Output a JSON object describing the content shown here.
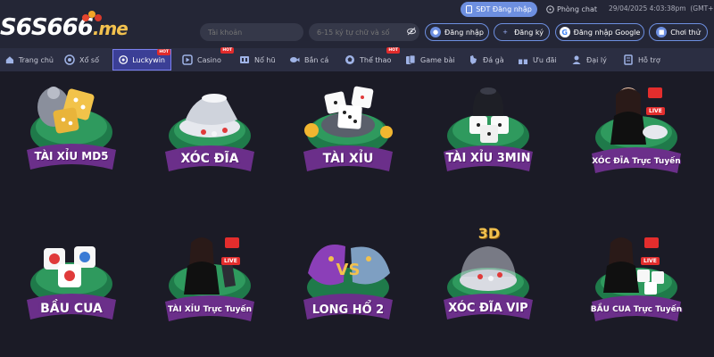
{
  "header": {
    "logo_text": "S6S666",
    "logo_suffix": ".me",
    "sdt_button": "SĐT Đăng nhập",
    "chat_button": "Phòng chat",
    "datetime": "29/04/2025 4:03:38pm",
    "timezone": "(GMT+7)",
    "username_placeholder": "Tài khoản",
    "password_placeholder": "6-15 ký tự chữ và số",
    "login_button": "Đăng nhập",
    "register_button": "Đăng ký",
    "google_button": "Đăng nhập Google",
    "trial_button": "Chơi thử",
    "colors": {
      "accent": "#6d8fe0",
      "background": "#242636"
    }
  },
  "nav": {
    "items": [
      {
        "label": "Trang chủ",
        "icon": "home-icon"
      },
      {
        "label": "Xổ số",
        "icon": "lottery-icon"
      },
      {
        "label": "Luckywin",
        "icon": "luckywin-icon",
        "active": true,
        "hot": "HOT"
      },
      {
        "label": "Casino",
        "icon": "casino-icon",
        "hot": "HOT"
      },
      {
        "label": "Nổ hũ",
        "icon": "slot-icon"
      },
      {
        "label": "Bắn cá",
        "icon": "fish-icon"
      },
      {
        "label": "Thể thao",
        "icon": "sports-icon",
        "hot": "HOT"
      },
      {
        "label": "Game bài",
        "icon": "cards-icon"
      },
      {
        "label": "Đá gà",
        "icon": "rooster-icon"
      },
      {
        "label": "Ưu đãi",
        "icon": "gift-icon"
      },
      {
        "label": "Đại lý",
        "icon": "agent-icon"
      },
      {
        "label": "Hỗ trợ",
        "icon": "support-icon"
      }
    ]
  },
  "games": [
    {
      "label": "TÀI XỈU MD5"
    },
    {
      "label": "XÓC ĐĨA"
    },
    {
      "label": "TÀI XỈU"
    },
    {
      "label": "TÀI XỈU 3MIN"
    },
    {
      "label": "XÓC ĐĨA Trực Tuyến",
      "live": "LIVE"
    },
    {
      "label": "BẦU CUA"
    },
    {
      "label": "TÀI XỈU Trực Tuyến",
      "live": "LIVE"
    },
    {
      "label": "LONG HỔ 2"
    },
    {
      "label": "XÓC ĐĨA VIP",
      "badge": "3D"
    },
    {
      "label": "BẦU CUA Trực Tuyến",
      "live": "LIVE"
    }
  ]
}
